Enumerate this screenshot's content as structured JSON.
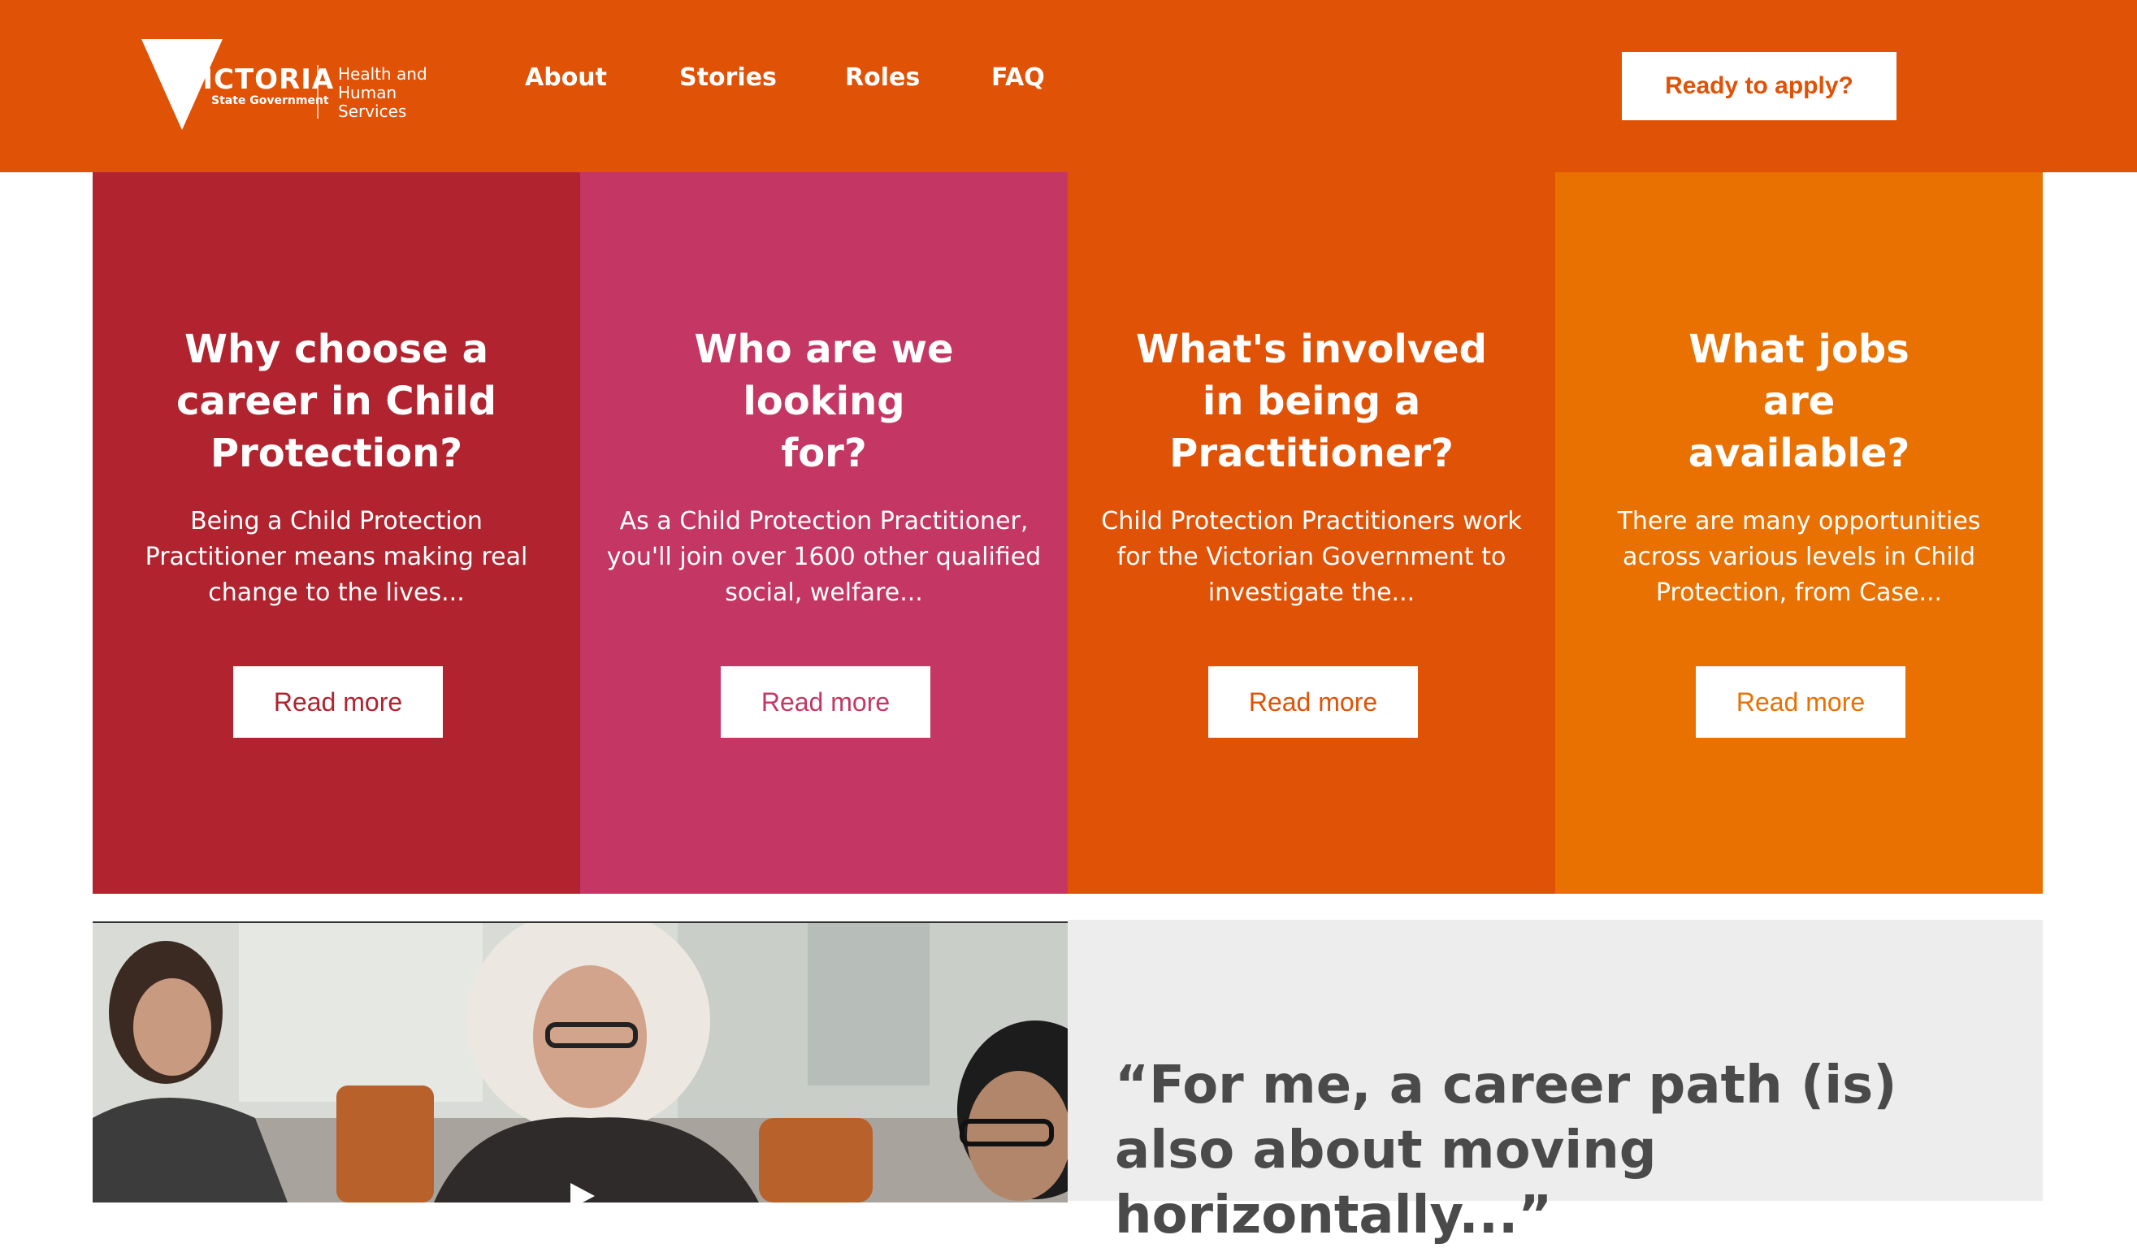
{
  "header": {
    "logo": {
      "wordmark": "VICTORIA",
      "subline": "State Government",
      "department": "Health and Human Services"
    },
    "nav": [
      {
        "label": "About"
      },
      {
        "label": "Stories"
      },
      {
        "label": "Roles"
      },
      {
        "label": "FAQ"
      }
    ],
    "cta_label": "Ready to apply?"
  },
  "cards": [
    {
      "title": "Why choose a career in Child Protection?",
      "excerpt": "Being a Child Protection Practitioner means making real change to the lives...",
      "button": "Read more",
      "color": "#b0232f"
    },
    {
      "title": "Who are we looking for?",
      "excerpt": "As a Child Protection Practitioner, you'll join over 1600 other qualified social, welfare...",
      "button": "Read more",
      "color": "#c43663"
    },
    {
      "title": "What's involved in being a Practitioner?",
      "excerpt": "Child Protection Practitioners work for the Victorian Government to investigate the...",
      "button": "Read more",
      "color": "#e05206"
    },
    {
      "title": "What jobs are available?",
      "excerpt": "There are many opportunities across various levels in Child Protection, from Case...",
      "button": "Read more",
      "color": "#e87102"
    }
  ],
  "quote": {
    "text": "“For me, a career path (is) also about moving horizontally...”"
  },
  "video": {
    "play_icon": "play-icon"
  },
  "colors": {
    "header_bg": "#e05206",
    "quote_bg": "#ecedec"
  }
}
